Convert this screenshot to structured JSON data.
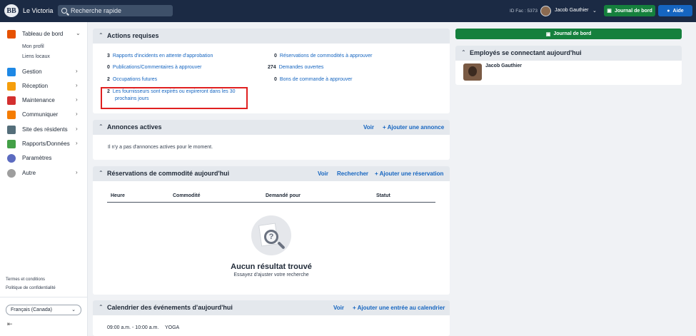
{
  "topbar": {
    "app_title": "Le Victoria",
    "search_placeholder": "Recherche rapide",
    "fac_id": "ID Fac : 5373",
    "user_name": "Jacob Gauthier",
    "logbook_label": "Journal de bord",
    "help_label": "Aide"
  },
  "sidebar": {
    "items": [
      {
        "label": "Tableau de bord",
        "icon": "dashboard-icon",
        "color": "#e65100"
      },
      {
        "label": "Gestion",
        "icon": "building-icon",
        "color": "#1e88e5"
      },
      {
        "label": "Réception",
        "icon": "bell-icon",
        "color": "#f59e0b"
      },
      {
        "label": "Maintenance",
        "icon": "toolbox-icon",
        "color": "#d32f2f"
      },
      {
        "label": "Communiquer",
        "icon": "envelope-icon",
        "color": "#f57c00"
      },
      {
        "label": "Site des résidents",
        "icon": "monitor-icon",
        "color": "#546e7a"
      },
      {
        "label": "Rapports/Données",
        "icon": "chart-icon",
        "color": "#43a047"
      },
      {
        "label": "Paramètres",
        "icon": "gear-icon",
        "color": "#5c6bc0"
      },
      {
        "label": "Autre",
        "icon": "more-icon",
        "color": "#9e9e9e"
      }
    ],
    "sub_items": [
      "Mon profil",
      "Liens locaux"
    ],
    "footer_links": [
      "Termes et conditions",
      "Politique de confidentialité"
    ],
    "language": "Français (Canada)"
  },
  "actions": {
    "title": "Actions requises",
    "left": [
      {
        "count": "3",
        "label": "Rapports d'incidents en attente d'approbation"
      },
      {
        "count": "0",
        "label": "Publications/Commentaires à approuver"
      },
      {
        "count": "2",
        "label": "Occupations futures"
      },
      {
        "count": "2",
        "label": "Les fournisseurs sont expirés ou expireront dans les 30",
        "label2": "prochains jours"
      }
    ],
    "right": [
      {
        "count": "0",
        "label": "Réservations de commodités à approuver"
      },
      {
        "count": "274",
        "label": "Demandes ouvertes"
      },
      {
        "count": "0",
        "label": "Bons de commande à approuver"
      }
    ]
  },
  "announcements": {
    "title": "Annonces actives",
    "view": "Voir",
    "add": "+ Ajouter une annonce",
    "empty": "Il n'y a pas d'annonces actives pour le moment."
  },
  "reservations": {
    "title": "Réservations de commodité aujourd'hui",
    "view": "Voir",
    "search": "Rechercher",
    "add": "+ Ajouter une réservation",
    "columns": [
      "Heure",
      "Commodité",
      "Demandé pour",
      "Statut"
    ],
    "empty_title": "Aucun résultat trouvé",
    "empty_sub": "Essayez d'ajuster votre recherche"
  },
  "calendar": {
    "title": "Calendrier des événements d'aujourd'hui",
    "view": "Voir",
    "add": "+ Ajouter une entrée au calendrier",
    "events": [
      {
        "time": "09:00 a.m. - 10:00 a.m.",
        "name": "YOGA"
      }
    ]
  },
  "right_panel": {
    "logbook_label": "Journal de bord",
    "employees_title": "Employés se connectant aujourd'hui",
    "employee_name": "Jacob Gauthier"
  }
}
